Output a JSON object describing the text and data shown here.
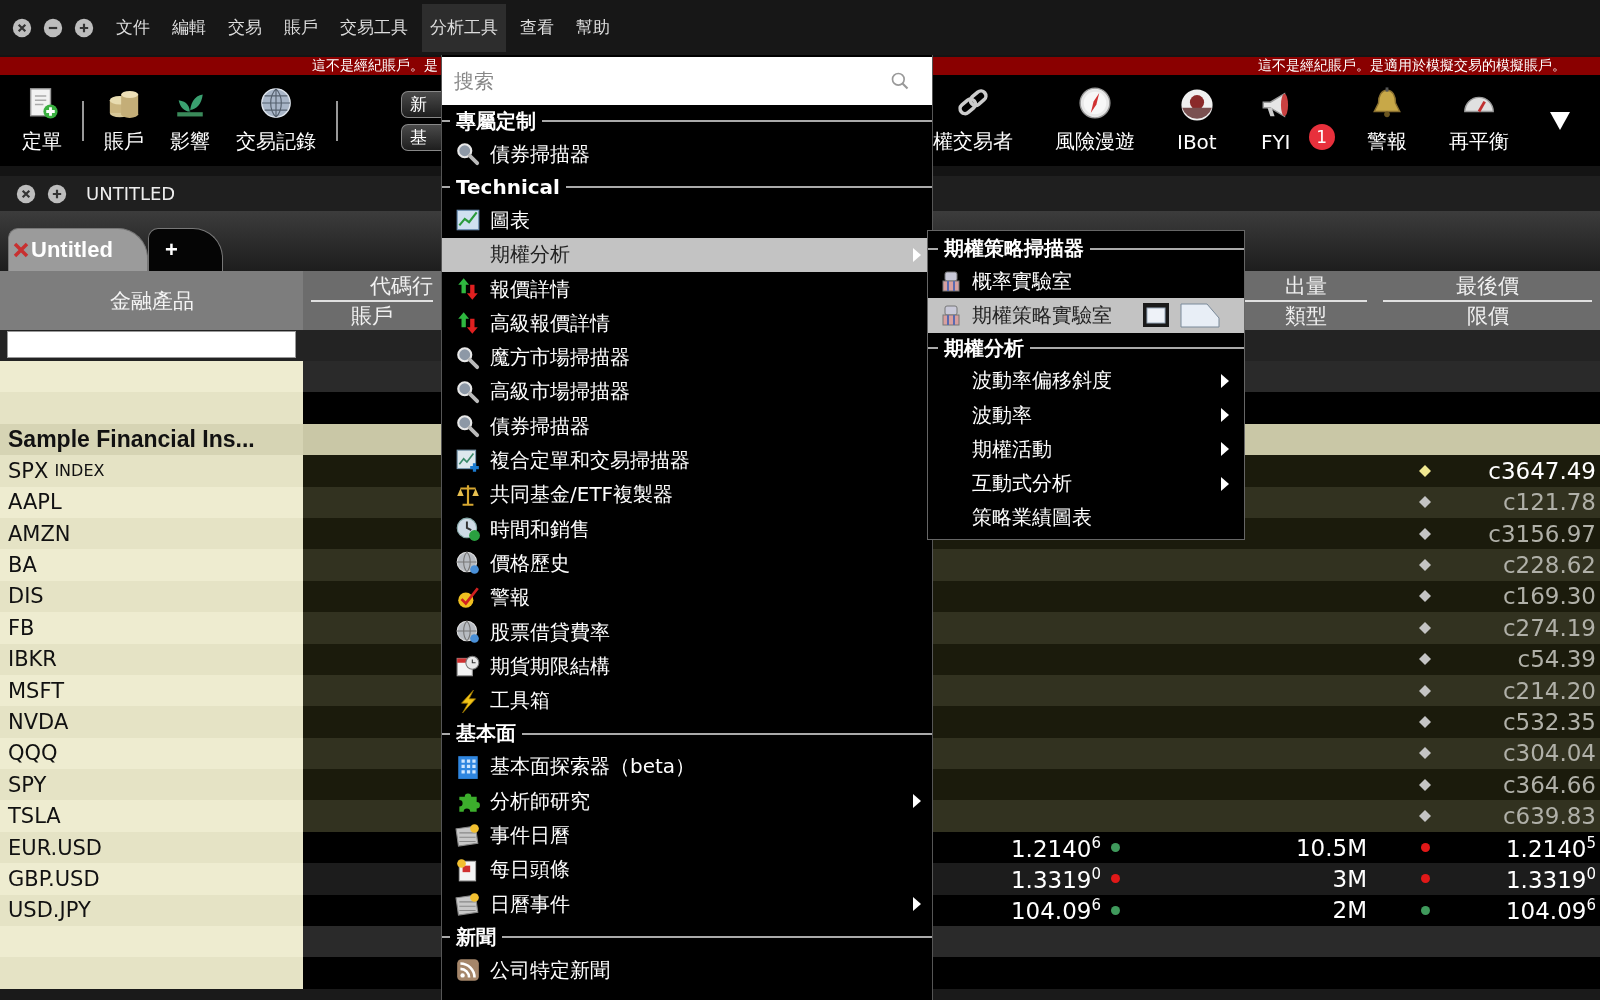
{
  "menubar": {
    "items": [
      {
        "label": "文件",
        "selected": false
      },
      {
        "label": "編輯",
        "selected": false
      },
      {
        "label": "交易",
        "selected": false
      },
      {
        "label": "賬戶",
        "selected": false
      },
      {
        "label": "交易工具",
        "selected": false
      },
      {
        "label": "分析工具",
        "selected": true
      },
      {
        "label": "查看",
        "selected": false
      },
      {
        "label": "幫助",
        "selected": false
      }
    ]
  },
  "banner": {
    "left_text": "這不是經紀賬戶。是",
    "right_text": "這不是經紀賬戶。是適用於模擬交易的模擬賬戶。"
  },
  "toolbar": {
    "left_items": [
      {
        "label": "定單"
      },
      {
        "label": "賬戶"
      },
      {
        "label": "影響"
      },
      {
        "label": "交易記錄"
      }
    ],
    "small_buttons": [
      "新",
      "基"
    ],
    "right_items": [
      {
        "label": "權交易者"
      },
      {
        "label": "風險漫遊"
      },
      {
        "label": "IBot"
      },
      {
        "label": "FYI",
        "badge": "1"
      },
      {
        "label": "警報"
      },
      {
        "label": "再平衡"
      }
    ]
  },
  "window": {
    "title": "UNTITLED"
  },
  "tabs": [
    {
      "label": "Untitled",
      "selected": true
    },
    {
      "label": "+",
      "selected": false
    }
  ],
  "table": {
    "columns": [
      {
        "top": "金融產品"
      },
      {
        "top": "代碼行",
        "bottom": "賬戶"
      },
      {
        "top": "出量",
        "bottom": "類型"
      },
      {
        "top": "最後價",
        "bottom": "限價"
      }
    ],
    "rows": [
      {
        "kind": "empty"
      },
      {
        "kind": "empty"
      },
      {
        "kind": "group",
        "symbol": "Sample Financial Ins..."
      },
      {
        "kind": "stock",
        "symbol": "SPX",
        "exchange": "INDEX",
        "last": "c3647.49",
        "active": true
      },
      {
        "kind": "stock",
        "symbol": "AAPL",
        "last": "c121.78",
        "active": false
      },
      {
        "kind": "stock",
        "symbol": "AMZN",
        "last": "c3156.97",
        "active": false
      },
      {
        "kind": "stock",
        "symbol": "BA",
        "last": "c228.62",
        "active": false
      },
      {
        "kind": "stock",
        "symbol": "DIS",
        "last": "c169.30",
        "active": false
      },
      {
        "kind": "stock",
        "symbol": "FB",
        "last": "c274.19",
        "active": false
      },
      {
        "kind": "stock",
        "symbol": "IBKR",
        "last": "c54.39",
        "active": false
      },
      {
        "kind": "stock",
        "symbol": "MSFT",
        "last": "c214.20",
        "active": false
      },
      {
        "kind": "stock",
        "symbol": "NVDA",
        "last": "c532.35",
        "active": false
      },
      {
        "kind": "stock",
        "symbol": "QQQ",
        "last": "c304.04",
        "active": false
      },
      {
        "kind": "stock",
        "symbol": "SPY",
        "last": "c364.66",
        "active": false
      },
      {
        "kind": "stock",
        "symbol": "TSLA",
        "last": "c639.83",
        "active": false
      },
      {
        "kind": "fx",
        "symbol": "EUR.USD",
        "bid": {
          "text": "1.2140$^{6}$",
          "color": "#3f9a5c"
        },
        "size": "10.5M",
        "last": {
          "text": "1.2140$^{5}$",
          "color": "#e01818"
        }
      },
      {
        "kind": "fx",
        "symbol": "GBP.USD",
        "bid": {
          "text": "1.3319$^{0}$",
          "color": "#e01818"
        },
        "size": "3M",
        "last": {
          "text": "1.3319$^{0}$",
          "color": "#e01818"
        }
      },
      {
        "kind": "fx",
        "symbol": "USD.JPY",
        "bid": {
          "text": "104.09$^{6}$",
          "color": "#3f9a5c"
        },
        "size": "2M",
        "last": {
          "text": "104.09$^{6}$",
          "color": "#3f9a5c"
        }
      },
      {
        "kind": "empty"
      },
      {
        "kind": "empty"
      }
    ]
  },
  "menu": {
    "search": {
      "placeholder": "搜索"
    },
    "sections": [
      {
        "title": "專屬定制",
        "items": [
          {
            "label": "債券掃描器",
            "selected": false,
            "submenu": false
          }
        ]
      },
      {
        "title": "Technical",
        "items": [
          {
            "label": "圖表",
            "selected": false,
            "submenu": false
          },
          {
            "label": "期權分析",
            "selected": true,
            "submenu": true
          },
          {
            "label": "報價詳情",
            "selected": false,
            "submenu": false
          },
          {
            "label": "高級報價詳情",
            "selected": false,
            "submenu": false
          },
          {
            "label": "魔方市場掃描器",
            "selected": false,
            "submenu": false
          },
          {
            "label": "高級市場掃描器",
            "selected": false,
            "submenu": false
          },
          {
            "label": "債券掃描器",
            "selected": false,
            "submenu": false
          },
          {
            "label": "複合定單和交易掃描器",
            "selected": false,
            "submenu": false
          },
          {
            "label": "共同基金/ETF複製器",
            "selected": false,
            "submenu": false
          },
          {
            "label": "時間和銷售",
            "selected": false,
            "submenu": false
          },
          {
            "label": "價格歷史",
            "selected": false,
            "submenu": false
          },
          {
            "label": "警報",
            "selected": false,
            "submenu": false
          },
          {
            "label": "股票借貸費率",
            "selected": false,
            "submenu": false
          },
          {
            "label": "期貨期限結構",
            "selected": false,
            "submenu": false
          },
          {
            "label": "工具箱",
            "selected": false,
            "submenu": false
          }
        ]
      },
      {
        "title": "基本面",
        "items": [
          {
            "label": "基本面探索器（beta）",
            "selected": false,
            "submenu": false
          },
          {
            "label": "分析師研究",
            "selected": false,
            "submenu": true
          },
          {
            "label": "事件日曆",
            "selected": false,
            "submenu": false
          },
          {
            "label": "每日頭條",
            "selected": false,
            "submenu": false
          },
          {
            "label": "日曆事件",
            "selected": false,
            "submenu": true
          }
        ]
      },
      {
        "title": "新聞",
        "items": [
          {
            "label": "公司特定新聞",
            "selected": false,
            "submenu": false
          }
        ]
      }
    ]
  },
  "submenu": {
    "sections": [
      {
        "title": "期權策略掃描器",
        "items": [
          {
            "label": "概率實驗室",
            "selected": false,
            "submenu": false
          },
          {
            "label": "期權策略實驗室",
            "selected": true,
            "submenu": false
          }
        ]
      },
      {
        "title": "期權分析",
        "items": [
          {
            "label": "波動率偏移斜度",
            "selected": false,
            "submenu": true
          },
          {
            "label": "波動率",
            "selected": false,
            "submenu": true
          },
          {
            "label": "期權活動",
            "selected": false,
            "submenu": true
          },
          {
            "label": "互動式分析",
            "selected": false,
            "submenu": true
          },
          {
            "label": "策略業績圖表",
            "selected": false,
            "submenu": false
          }
        ]
      }
    ]
  }
}
